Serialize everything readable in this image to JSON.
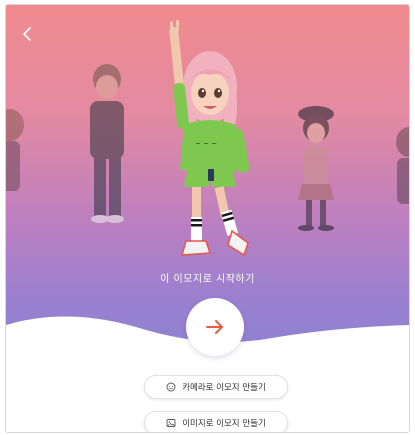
{
  "back": {
    "icon": "chevron-left-icon"
  },
  "hero": {
    "start_label": "이 이모지로 시작하기"
  },
  "next_button": {
    "icon": "arrow-right-icon",
    "color": "#ef5a45"
  },
  "options": [
    {
      "icon": "face-icon",
      "label": "카메라로 이모지 만들기"
    },
    {
      "icon": "image-icon",
      "label": "이미지로 이모지 만들기"
    }
  ],
  "colors": {
    "gradient_top": "#f08a8e",
    "gradient_bottom": "#8b82d2",
    "accent": "#ef5a45"
  }
}
